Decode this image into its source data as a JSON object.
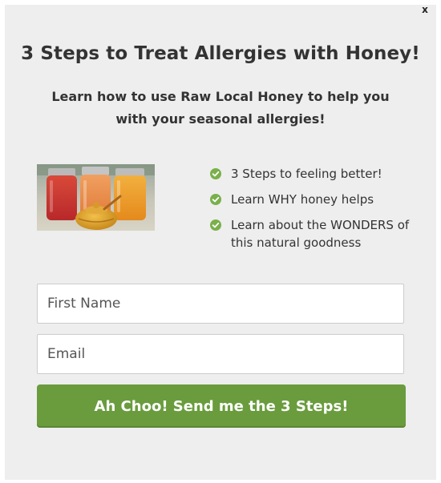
{
  "popup": {
    "close_label": "x",
    "title": "3 Steps to Treat Allergies with Honey!",
    "subtitle": "Learn how to use Raw Local Honey to help you with your seasonal allergies!"
  },
  "benefits": [
    {
      "text": "3 Steps to feeling better!",
      "icon": "check-circle-icon"
    },
    {
      "text": "Learn WHY honey helps",
      "icon": "check-circle-icon"
    },
    {
      "text": "Learn about the WONDERS of this natural goodness",
      "icon": "check-circle-icon"
    }
  ],
  "form": {
    "first_name_placeholder": "First Name",
    "email_placeholder": "Email",
    "submit_label": "Ah Choo! Send me the 3 Steps!"
  },
  "colors": {
    "background": "#eeeeee",
    "accent_green": "#6a9c3e",
    "check_green": "#79b04a",
    "text": "#333333"
  }
}
